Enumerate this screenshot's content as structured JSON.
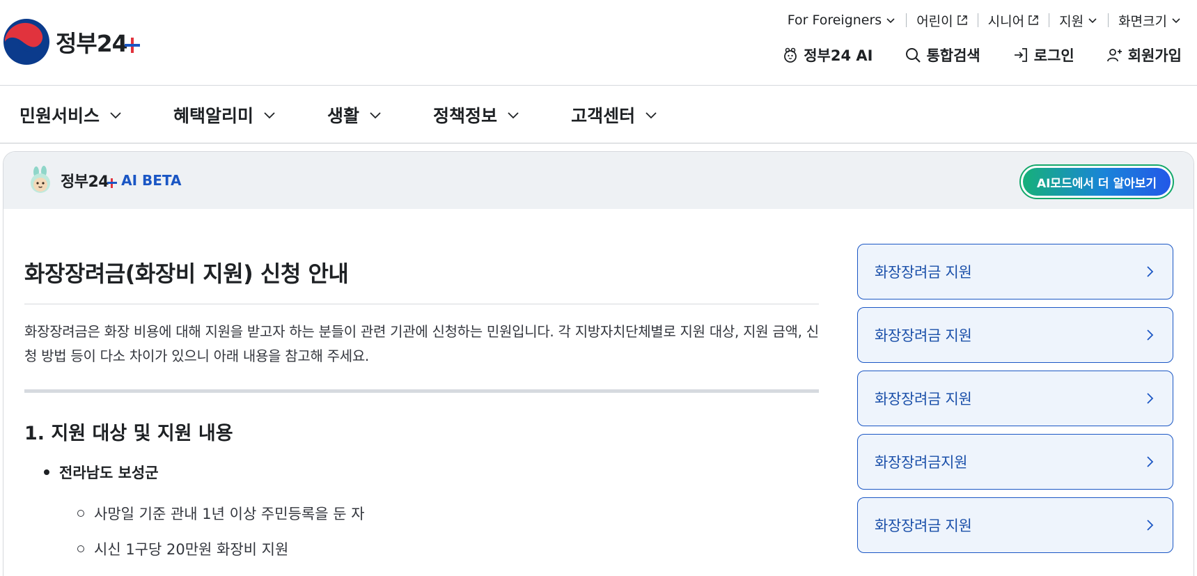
{
  "header": {
    "logo_text": "정부24",
    "util_nav": [
      {
        "label": "For Foreigners",
        "icon": "chevron-down-icon"
      },
      {
        "label": "어린이",
        "icon": "external-link-icon"
      },
      {
        "label": "시니어",
        "icon": "external-link-icon"
      },
      {
        "label": "지원",
        "icon": "chevron-down-icon"
      },
      {
        "label": "화면크기",
        "icon": "chevron-down-icon"
      }
    ],
    "main_util": [
      {
        "label": "정부24 AI",
        "icon": "mascot-icon"
      },
      {
        "label": "통합검색",
        "icon": "search-icon"
      },
      {
        "label": "로그인",
        "icon": "login-icon"
      },
      {
        "label": "회원가입",
        "icon": "user-add-icon"
      }
    ]
  },
  "gnb": {
    "items": [
      {
        "label": "민원서비스"
      },
      {
        "label": "혜택알리미"
      },
      {
        "label": "생활"
      },
      {
        "label": "정책정보"
      },
      {
        "label": "고객센터"
      }
    ]
  },
  "ai_panel": {
    "brand": "정부24",
    "beta_label": "AI BETA",
    "mode_button": "AI모드에서 더 알아보기"
  },
  "article": {
    "title": "화장장려금(화장비 지원) 신청 안내",
    "description": "화장장려금은 화장 비용에 대해 지원을 받고자 하는 분들이 관련 기관에 신청하는 민원입니다. 각 지방자치단체별로 지원 대상, 지원 금액, 신청 방법 등이 다소 차이가 있으니 아래 내용을 참고해 주세요.",
    "section_title": "1. 지원 대상 및 지원 내용",
    "region": "전라남도 보성군",
    "details": [
      "사망일 기준 관내 1년 이상 주민등록을 둔 자",
      "시신 1구당 20만원 화장비 지원"
    ]
  },
  "related": [
    {
      "label": "화장장려금 지원"
    },
    {
      "label": "화장장려금 지원"
    },
    {
      "label": "화장장려금 지원"
    },
    {
      "label": "화장장려금지원"
    },
    {
      "label": "화장장려금 지원"
    }
  ],
  "colors": {
    "brand_blue": "#1a56c4",
    "brand_red": "#e1333d",
    "card_bg": "#eef4fc",
    "panel_head_bg": "#eef1f4"
  }
}
